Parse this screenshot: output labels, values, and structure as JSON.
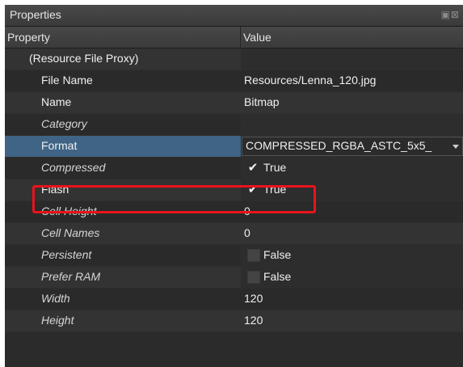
{
  "panel": {
    "title": "Properties",
    "title_buttons_icon": "restore-close-icons"
  },
  "header": {
    "property": "Property",
    "value": "Value"
  },
  "rows": [
    {
      "label": "(Resource File Proxy)",
      "value": "",
      "italic": false,
      "indent": 30
    },
    {
      "label": "File Name",
      "value": "Resources/Lenna_120.jpg",
      "italic": false,
      "indent": 45
    },
    {
      "label": "Name",
      "value": "Bitmap",
      "italic": false,
      "indent": 45
    },
    {
      "label": "Category",
      "value": "",
      "italic": true,
      "indent": 45
    },
    {
      "label": "Format",
      "value": "COMPRESSED_RGBA_ASTC_5x5_",
      "italic": false,
      "indent": 45,
      "selected": true,
      "type": "dropdown"
    },
    {
      "label": "Compressed",
      "value": "True",
      "italic": true,
      "indent": 45,
      "type": "checkbox",
      "checked": true
    },
    {
      "label": "Flash",
      "value": "True",
      "italic": false,
      "indent": 45,
      "type": "checkbox",
      "checked": true
    },
    {
      "label": "Cell Height",
      "value": "0",
      "italic": true,
      "indent": 45
    },
    {
      "label": "Cell Names",
      "value": "0",
      "italic": true,
      "indent": 45
    },
    {
      "label": "Persistent",
      "value": "False",
      "italic": true,
      "indent": 45,
      "type": "checkbox",
      "checked": false
    },
    {
      "label": "Prefer RAM",
      "value": "False",
      "italic": true,
      "indent": 45,
      "type": "checkbox",
      "checked": false
    },
    {
      "label": "Width",
      "value": "120",
      "italic": true,
      "indent": 45
    },
    {
      "label": "Height",
      "value": "120",
      "italic": true,
      "indent": 45
    }
  ],
  "colors": {
    "highlight": "#e8141c",
    "selected_row": "#3f6485"
  }
}
